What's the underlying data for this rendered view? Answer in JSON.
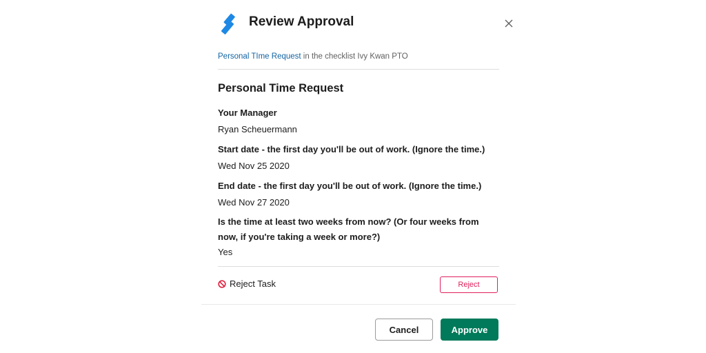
{
  "colors": {
    "brand_blue": "#1e88e5",
    "link": "#1264a3",
    "danger": "#e01e5a",
    "primary": "#007a5a"
  },
  "header": {
    "title": "Review Approval",
    "logo_icon": "process-street-logo-icon",
    "close_icon": "close-icon"
  },
  "context": {
    "link_text": "Personal TIme Request",
    "rest_text": " in the checklist Ivy Kwan PTO"
  },
  "form": {
    "title": "Personal Time Request",
    "fields": [
      {
        "question": "Your Manager",
        "answer": "Ryan Scheuermann"
      },
      {
        "question": "Start date - the first day you'll be out of work. (Ignore the time.)",
        "answer": "Wed Nov 25 2020"
      },
      {
        "question": "End date - the first day you'll be out of work. (Ignore the time.)",
        "answer": "Wed Nov 27 2020"
      },
      {
        "question": "Is the time at least two weeks from now? (Or four weeks from now, if you're taking a week or more?)",
        "answer": "Yes"
      }
    ]
  },
  "reject": {
    "icon": "no-entry-icon",
    "label": "Reject Task",
    "button_label": "Reject"
  },
  "footer": {
    "cancel_label": "Cancel",
    "approve_label": "Approve"
  }
}
